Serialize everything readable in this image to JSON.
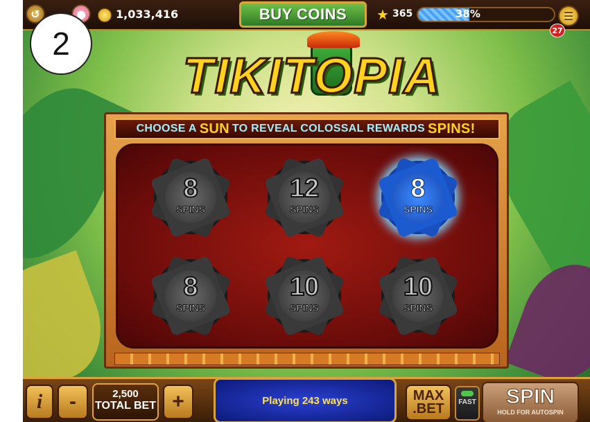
{
  "step_marker": "2",
  "topbar": {
    "balance": "1,033,416",
    "buy_coins_label": "BUY COINS",
    "level": "365",
    "xp_percent_label": "38%",
    "xp_fraction": 0.38,
    "notification_count": "27"
  },
  "game": {
    "logo_text": "TIKITOPIA",
    "banner": {
      "prefix": "CHOOSE A",
      "highlight1": "SUN",
      "middle": "TO REVEAL COLOSSAL REWARDS",
      "highlight2": "SPINS!"
    },
    "suns": [
      {
        "value": "8",
        "label": "SPINS",
        "active": false
      },
      {
        "value": "12",
        "label": "SPINS",
        "active": false
      },
      {
        "value": "8",
        "label": "SPINS",
        "active": true
      },
      {
        "value": "8",
        "label": "SPINS",
        "active": false
      },
      {
        "value": "10",
        "label": "SPINS",
        "active": false
      },
      {
        "value": "10",
        "label": "SPINS",
        "active": false
      }
    ]
  },
  "bottombar": {
    "info_label": "i",
    "minus_label": "-",
    "plus_label": "+",
    "total_bet_value": "2,500",
    "total_bet_label": "TOTAL BET",
    "message": "Playing 243 ways",
    "max_bet_line1": "MAX",
    "max_bet_line2": ".BET",
    "fast_label": "FAST",
    "spin_label": "SPIN",
    "spin_sub": "HOLD FOR AUTOSPIN"
  }
}
